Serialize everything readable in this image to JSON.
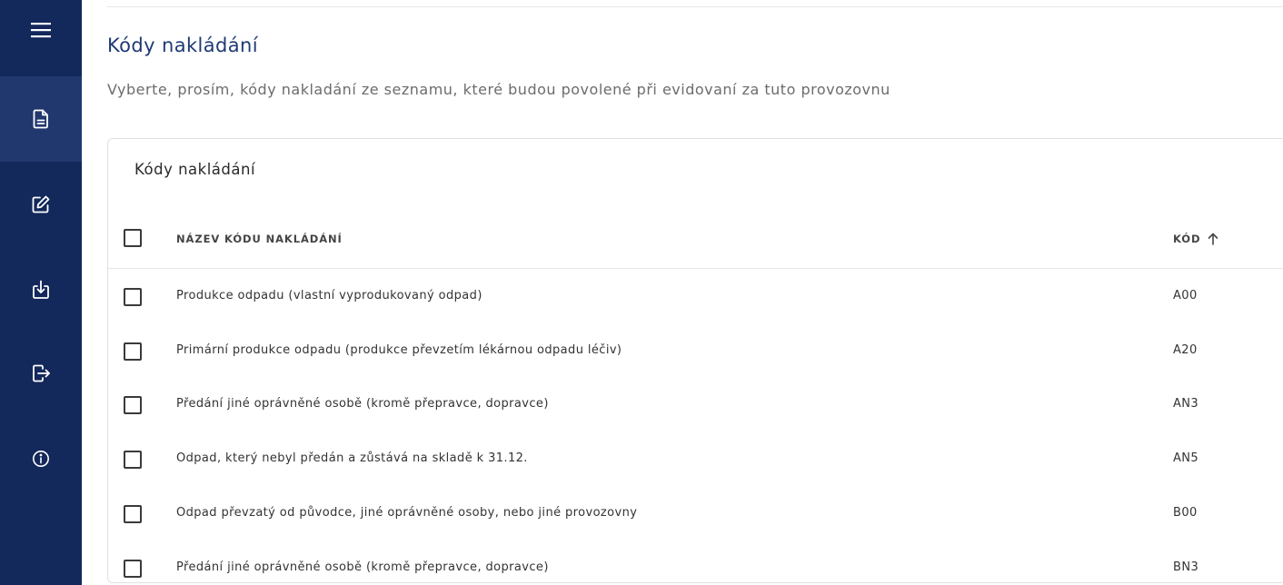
{
  "sidebar": {
    "menu_icon": "hamburger-menu-icon",
    "items": [
      {
        "icon": "document-icon",
        "active": true
      },
      {
        "icon": "edit-icon",
        "active": false
      },
      {
        "icon": "download-icon",
        "active": false
      },
      {
        "icon": "logout-icon",
        "active": false
      },
      {
        "icon": "info-icon",
        "active": false
      }
    ],
    "background": "#13285b",
    "active_background": "#21386e"
  },
  "page": {
    "title": "Kódy nakládání",
    "subtitle": "Vyberte, prosím, kódy nakladání ze seznamu, které budou povolené při evidovaní za tuto provozovnu"
  },
  "card": {
    "title": "Kódy nakládání",
    "columns": {
      "name": "NÁZEV KÓDU NAKLÁDÁNÍ",
      "code": "KÓD",
      "sort_icon": "arrow-up-icon"
    },
    "rows": [
      {
        "name": "Produkce odpadu (vlastní vyprodukovaný odpad)",
        "code": "A00",
        "checked": false
      },
      {
        "name": "Primární produkce odpadu (produkce převzetím lékárnou odpadu léčiv)",
        "code": "A20",
        "checked": false
      },
      {
        "name": "Předání jiné oprávněné osobě (kromě přepravce, dopravce)",
        "code": "AN3",
        "checked": false
      },
      {
        "name": "Odpad, který nebyl předán a zůstává na skladě k 31.12.",
        "code": "AN5",
        "checked": false
      },
      {
        "name": "Odpad převzatý od původce, jiné oprávněné osoby, nebo jiné provozovny",
        "code": "B00",
        "checked": false
      },
      {
        "name": "Předání jiné oprávněné osobě (kromě přepravce, dopravce)",
        "code": "BN3",
        "checked": false
      }
    ]
  }
}
